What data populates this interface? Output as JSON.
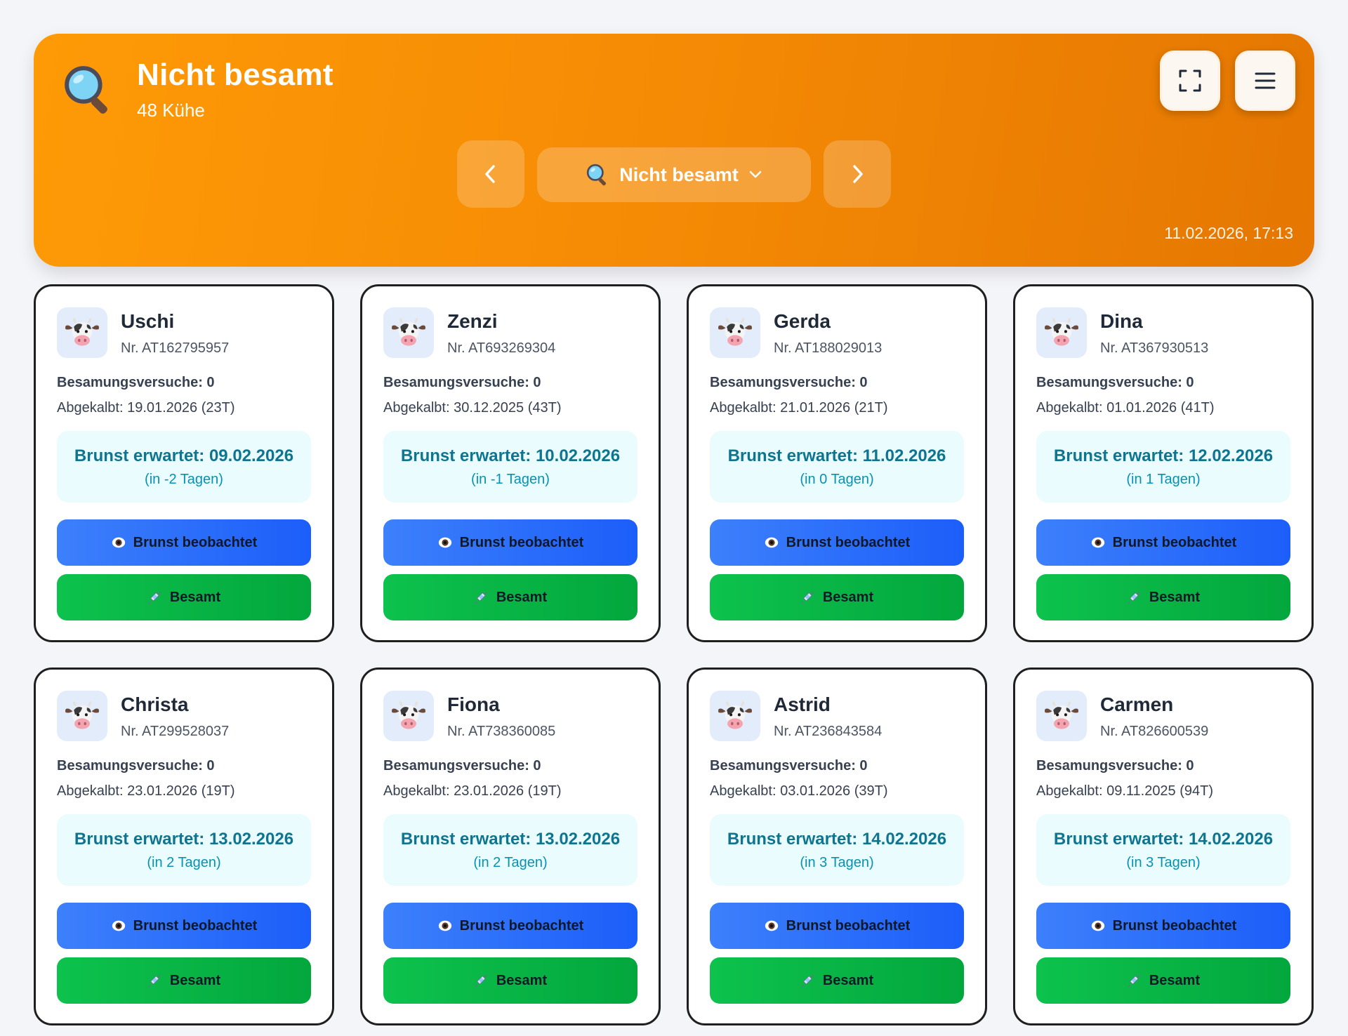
{
  "header": {
    "title": "Nicht besamt",
    "subtitle": "48 Kühe",
    "icon": "magnifier-icon",
    "nav": {
      "prev": "chevron-left-icon",
      "next": "chevron-right-icon",
      "select_label": "Nicht besamt"
    },
    "datetime": "11.02.2026, 17:13",
    "actions": [
      "fullscreen-icon",
      "menu-icon"
    ]
  },
  "cards": [
    {
      "name": "Uschi",
      "nr": "Nr. AT162795957",
      "attempts": "Besamungsversuche: 0",
      "calved": "Abgekalbt: 19.01.2026 (23T)",
      "heat": "Brunst erwartet: 09.02.2026",
      "heat_rel": "(in -2 Tagen)",
      "btn_observed": "Brunst beobachtet",
      "btn_inseminated": "Besamt"
    },
    {
      "name": "Zenzi",
      "nr": "Nr. AT693269304",
      "attempts": "Besamungsversuche: 0",
      "calved": "Abgekalbt: 30.12.2025 (43T)",
      "heat": "Brunst erwartet: 10.02.2026",
      "heat_rel": "(in -1 Tagen)",
      "btn_observed": "Brunst beobachtet",
      "btn_inseminated": "Besamt"
    },
    {
      "name": "Gerda",
      "nr": "Nr. AT188029013",
      "attempts": "Besamungsversuche: 0",
      "calved": "Abgekalbt: 21.01.2026 (21T)",
      "heat": "Brunst erwartet: 11.02.2026",
      "heat_rel": "(in 0 Tagen)",
      "btn_observed": "Brunst beobachtet",
      "btn_inseminated": "Besamt"
    },
    {
      "name": "Dina",
      "nr": "Nr. AT367930513",
      "attempts": "Besamungsversuche: 0",
      "calved": "Abgekalbt: 01.01.2026 (41T)",
      "heat": "Brunst erwartet: 12.02.2026",
      "heat_rel": "(in 1 Tagen)",
      "btn_observed": "Brunst beobachtet",
      "btn_inseminated": "Besamt"
    },
    {
      "name": "Christa",
      "nr": "Nr. AT299528037",
      "attempts": "Besamungsversuche: 0",
      "calved": "Abgekalbt: 23.01.2026 (19T)",
      "heat": "Brunst erwartet: 13.02.2026",
      "heat_rel": "(in 2 Tagen)",
      "btn_observed": "Brunst beobachtet",
      "btn_inseminated": "Besamt"
    },
    {
      "name": "Fiona",
      "nr": "Nr. AT738360085",
      "attempts": "Besamungsversuche: 0",
      "calved": "Abgekalbt: 23.01.2026 (19T)",
      "heat": "Brunst erwartet: 13.02.2026",
      "heat_rel": "(in 2 Tagen)",
      "btn_observed": "Brunst beobachtet",
      "btn_inseminated": "Besamt"
    },
    {
      "name": "Astrid",
      "nr": "Nr. AT236843584",
      "attempts": "Besamungsversuche: 0",
      "calved": "Abgekalbt: 03.01.2026 (39T)",
      "heat": "Brunst erwartet: 14.02.2026",
      "heat_rel": "(in 3 Tagen)",
      "btn_observed": "Brunst beobachtet",
      "btn_inseminated": "Besamt"
    },
    {
      "name": "Carmen",
      "nr": "Nr. AT826600539",
      "attempts": "Besamungsversuche: 0",
      "calved": "Abgekalbt: 09.11.2025 (94T)",
      "heat": "Brunst erwartet: 14.02.2026",
      "heat_rel": "(in 3 Tagen)",
      "btn_observed": "Brunst beobachtet",
      "btn_inseminated": "Besamt"
    }
  ],
  "colors": {
    "header_orange": "#fe9a06",
    "observed_blue": "#1c5ef9",
    "inseminated_green": "#03a73d",
    "heat_text": "#0e7490"
  }
}
